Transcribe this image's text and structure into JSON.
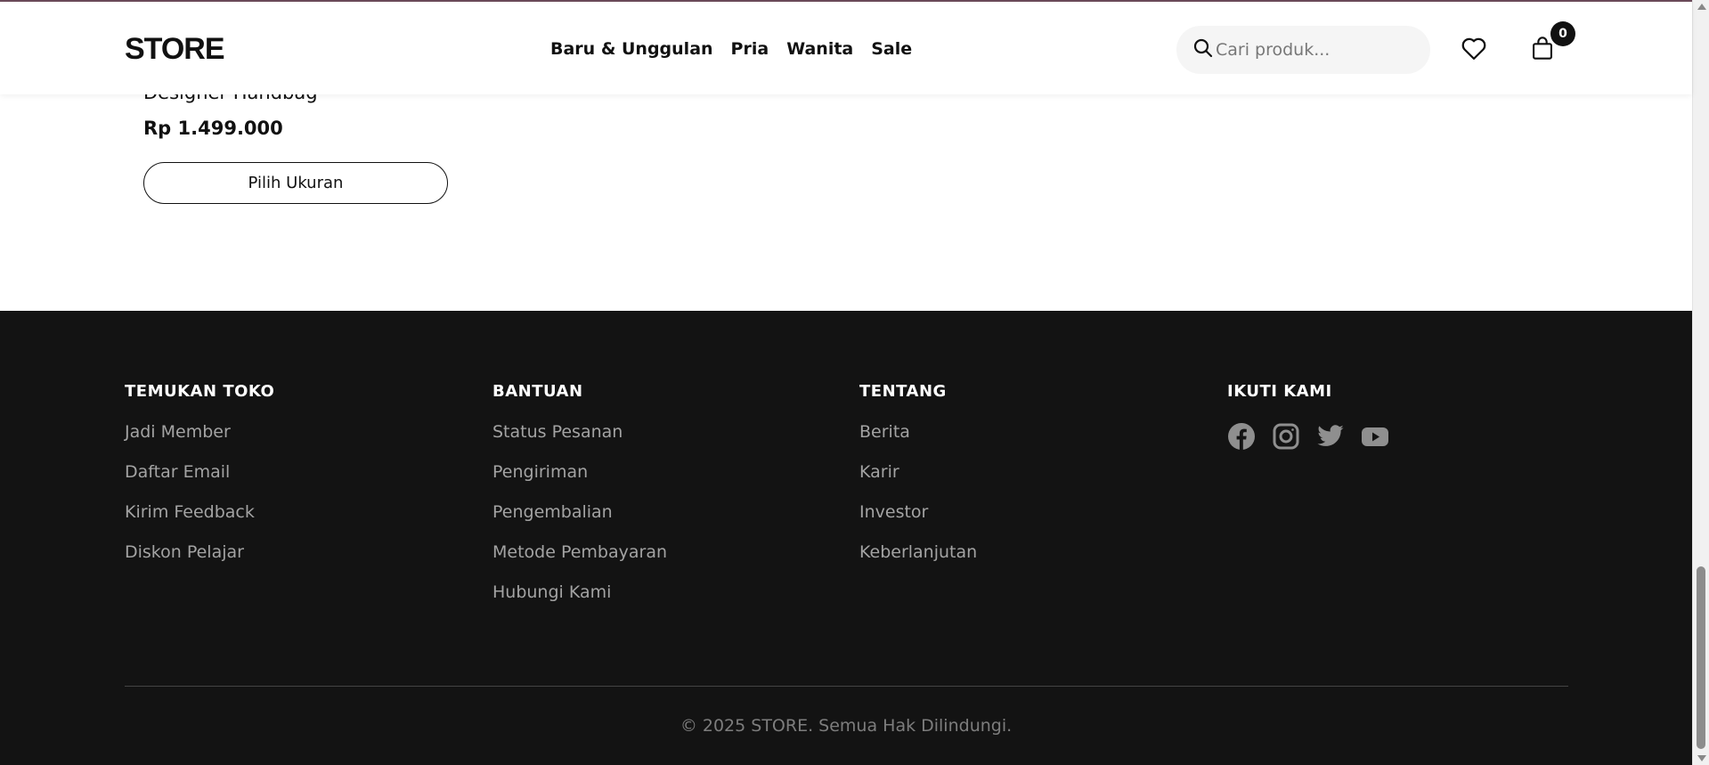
{
  "header": {
    "logo": "STORE",
    "nav": [
      "Baru & Unggulan",
      "Pria",
      "Wanita",
      "Sale"
    ],
    "search_placeholder": "Cari produk...",
    "cart_count": "0"
  },
  "product": {
    "name": "Designer Handbag",
    "price": "Rp 1.499.000",
    "button_label": "Pilih Ukuran"
  },
  "footer": {
    "columns": [
      {
        "title": "TEMUKAN TOKO",
        "links": [
          "Jadi Member",
          "Daftar Email",
          "Kirim Feedback",
          "Diskon Pelajar"
        ]
      },
      {
        "title": "BANTUAN",
        "links": [
          "Status Pesanan",
          "Pengiriman",
          "Pengembalian",
          "Metode Pembayaran",
          "Hubungi Kami"
        ]
      },
      {
        "title": "TENTANG",
        "links": [
          "Berita",
          "Karir",
          "Investor",
          "Keberlanjutan"
        ]
      },
      {
        "title": "IKUTI KAMI",
        "socials": [
          "facebook-icon",
          "instagram-icon",
          "twitter-icon",
          "youtube-icon"
        ]
      }
    ],
    "copyright": "© 2025 STORE. Semua Hak Dilindungi."
  },
  "colors": {
    "footer_bg": "#131313",
    "footer_link": "#a3a3a3",
    "text_dark": "#111111"
  }
}
